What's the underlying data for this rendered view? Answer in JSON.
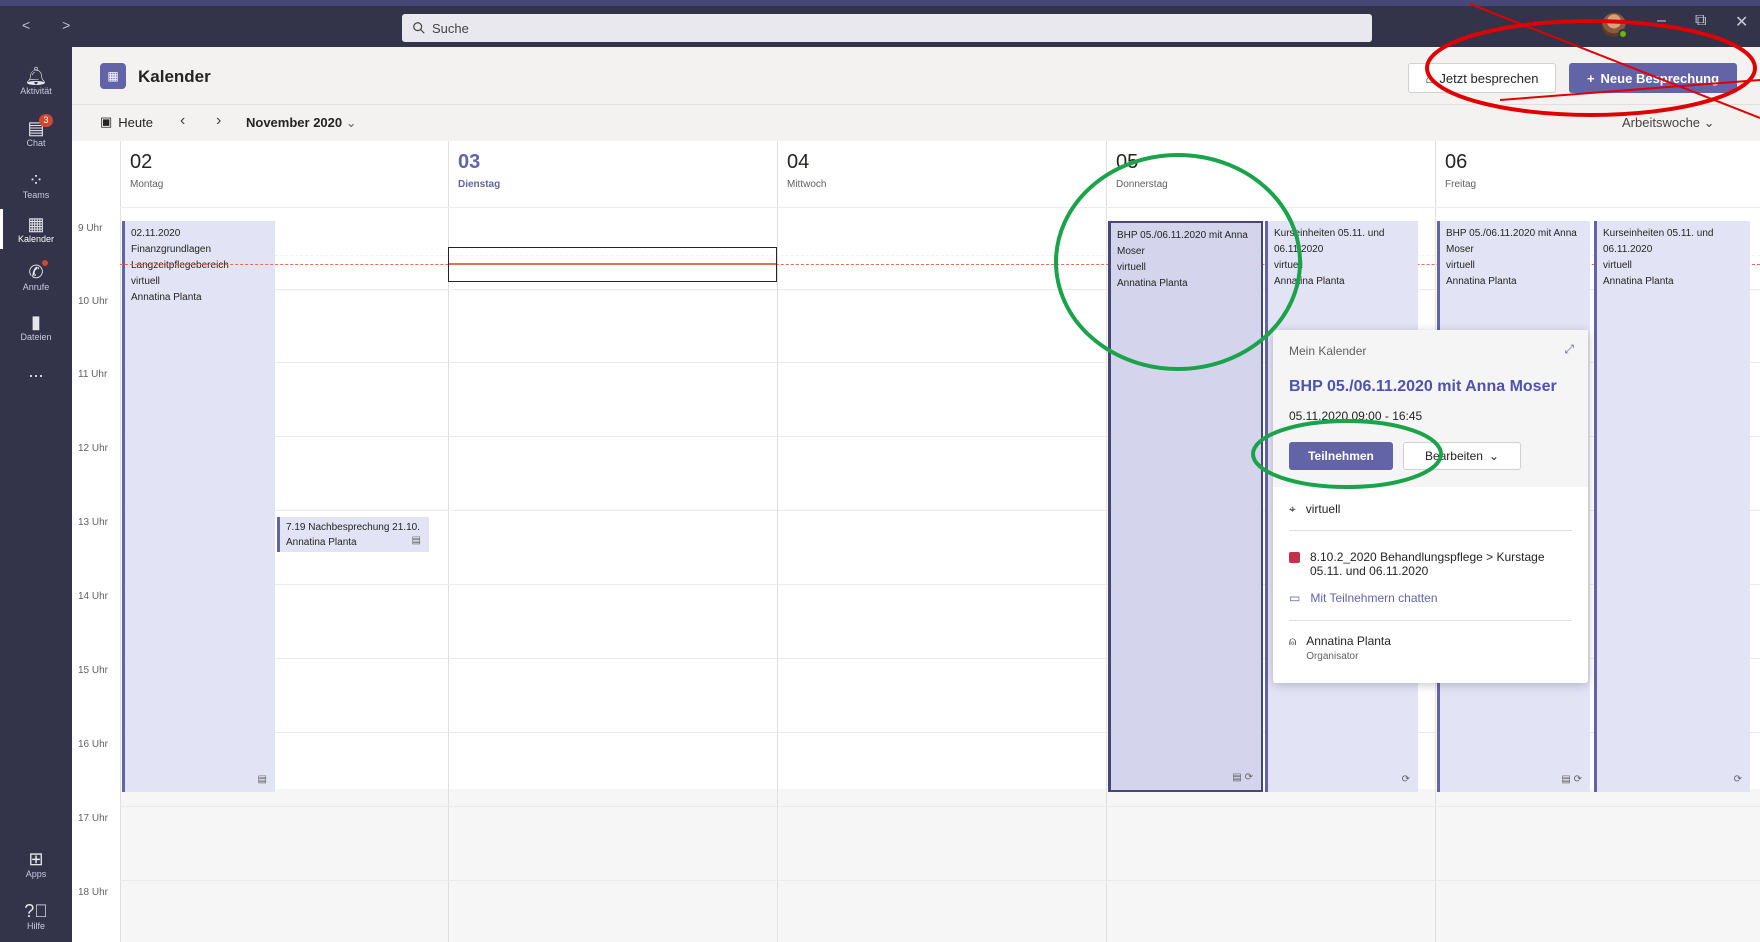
{
  "titlebar": {
    "search_placeholder": "Suche",
    "nav": "<  >",
    "minimize": "–",
    "maximize": "⧉",
    "close": "✕"
  },
  "rail": {
    "items": [
      {
        "label": "Aktivität",
        "icon": "bell-icon"
      },
      {
        "label": "Chat",
        "icon": "chat-icon",
        "badge": "3"
      },
      {
        "label": "Teams",
        "icon": "teams-icon"
      },
      {
        "label": "Kalender",
        "icon": "calendar-icon"
      },
      {
        "label": "Anrufe",
        "icon": "phone-icon"
      },
      {
        "label": "Dateien",
        "icon": "file-icon"
      },
      {
        "label": "...",
        "icon": "more-icon"
      },
      {
        "label": "Apps",
        "icon": "apps-icon"
      },
      {
        "label": "Hilfe",
        "icon": "help-icon"
      }
    ]
  },
  "header": {
    "title": "Kalender",
    "meet_now": "Jetzt besprechen",
    "new_meeting": "Neue Besprechung"
  },
  "toolbar": {
    "today": "Heute",
    "month": "November 2020",
    "view": "Arbeitswoche"
  },
  "days": [
    {
      "num": "02",
      "name": "Montag"
    },
    {
      "num": "03",
      "name": "Dienstag"
    },
    {
      "num": "04",
      "name": "Mittwoch"
    },
    {
      "num": "05",
      "name": "Donnerstag"
    },
    {
      "num": "06",
      "name": "Freitag"
    }
  ],
  "hours": [
    "9 Uhr",
    "10 Uhr",
    "11 Uhr",
    "12 Uhr",
    "13 Uhr",
    "14 Uhr",
    "15 Uhr",
    "16 Uhr",
    "17 Uhr",
    "18 Uhr"
  ],
  "events": {
    "mon1": {
      "line1": "02.11.2020",
      "line2": "Finanzgrundlagen",
      "line3": "Langzeitpflegebereich",
      "line4": "virtuell",
      "line5": "Annatina Planta"
    },
    "mon2": {
      "line1": "7.19 Nachbesprechung 21.10.",
      "line2": "Annatina Planta"
    },
    "thu1": {
      "line1": "BHP 05./06.11.2020 mit Anna",
      "line2": "Moser",
      "line3": "virtuell",
      "line4": "Annatina Planta"
    },
    "thu2": {
      "line1": "Kurseinheiten 05.11. und",
      "line2": "06.11.2020",
      "line3": "virtuell",
      "line4": "Annatina Planta"
    },
    "fri1": {
      "line1": "BHP 05./06.11.2020 mit Anna",
      "line2": "Moser",
      "line3": "virtuell",
      "line4": "Annatina Planta"
    },
    "fri2": {
      "line1": "Kurseinheiten 05.11. und",
      "line2": "06.11.2020",
      "line3": "virtuell",
      "line4": "Annatina Planta"
    }
  },
  "popup": {
    "calendar": "Mein Kalender",
    "title": "BHP 05./06.11.2020 mit Anna Moser",
    "time": "05.11.2020 09:00 - 16:45",
    "join": "Teilnehmen",
    "edit": "Bearbeiten",
    "location": "virtuell",
    "channel_line1": "8.10.2_2020 Behandlungspflege > Kurstage",
    "channel_line2": "05.11. und 06.11.2020",
    "chat": "Mit Teilnehmern chatten",
    "organizer": "Annatina Planta",
    "organizer_role": "Organisator"
  },
  "colors": {
    "accent": "#6264a7",
    "rail": "#33344a",
    "annotation_red": "#e00000",
    "annotation_green": "#1aa34a"
  }
}
